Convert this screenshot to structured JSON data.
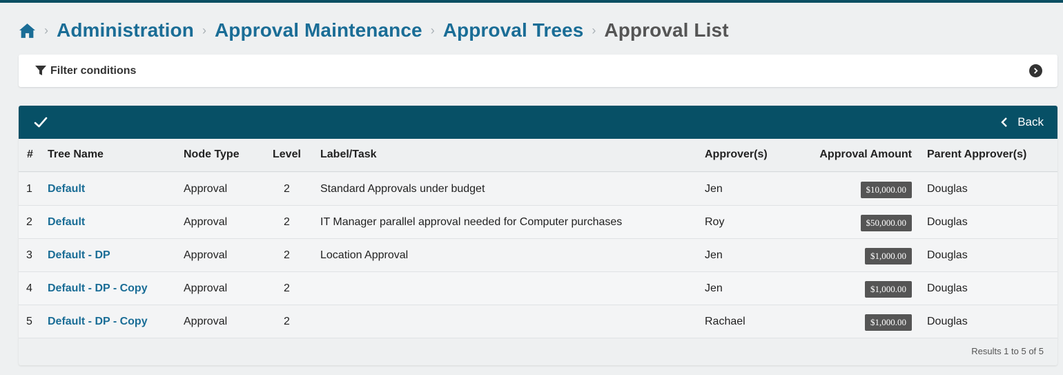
{
  "breadcrumb": {
    "items": [
      "Administration",
      "Approval Maintenance",
      "Approval Trees"
    ],
    "current": "Approval List"
  },
  "filter": {
    "label": "Filter conditions"
  },
  "toolbar": {
    "back_label": "Back"
  },
  "table": {
    "columns": [
      "#",
      "Tree Name",
      "Node Type",
      "Level",
      "Label/Task",
      "Approver(s)",
      "Approval Amount",
      "Parent Approver(s)"
    ],
    "rows": [
      {
        "num": "1",
        "tree": "Default",
        "node": "Approval",
        "level": "2",
        "label": "Standard Approvals under budget",
        "approver": "Jen",
        "amount": "$10,000.00",
        "parent": "Douglas"
      },
      {
        "num": "2",
        "tree": "Default",
        "node": "Approval",
        "level": "2",
        "label": "IT Manager parallel approval needed for Computer purchases",
        "approver": "Roy",
        "amount": "$50,000.00",
        "parent": "Douglas"
      },
      {
        "num": "3",
        "tree": "Default - DP",
        "node": "Approval",
        "level": "2",
        "label": "Location Approval",
        "approver": "Jen",
        "amount": "$1,000.00",
        "parent": "Douglas"
      },
      {
        "num": "4",
        "tree": "Default - DP - Copy",
        "node": "Approval",
        "level": "2",
        "label": "",
        "approver": "Jen",
        "amount": "$1,000.00",
        "parent": "Douglas"
      },
      {
        "num": "5",
        "tree": "Default - DP - Copy",
        "node": "Approval",
        "level": "2",
        "label": "",
        "approver": "Rachael",
        "amount": "$1,000.00",
        "parent": "Douglas"
      }
    ]
  },
  "results_text": "Results 1 to 5 of 5",
  "colors": {
    "brand": "#075066",
    "link": "#1a6d96",
    "badge": "#555555"
  }
}
